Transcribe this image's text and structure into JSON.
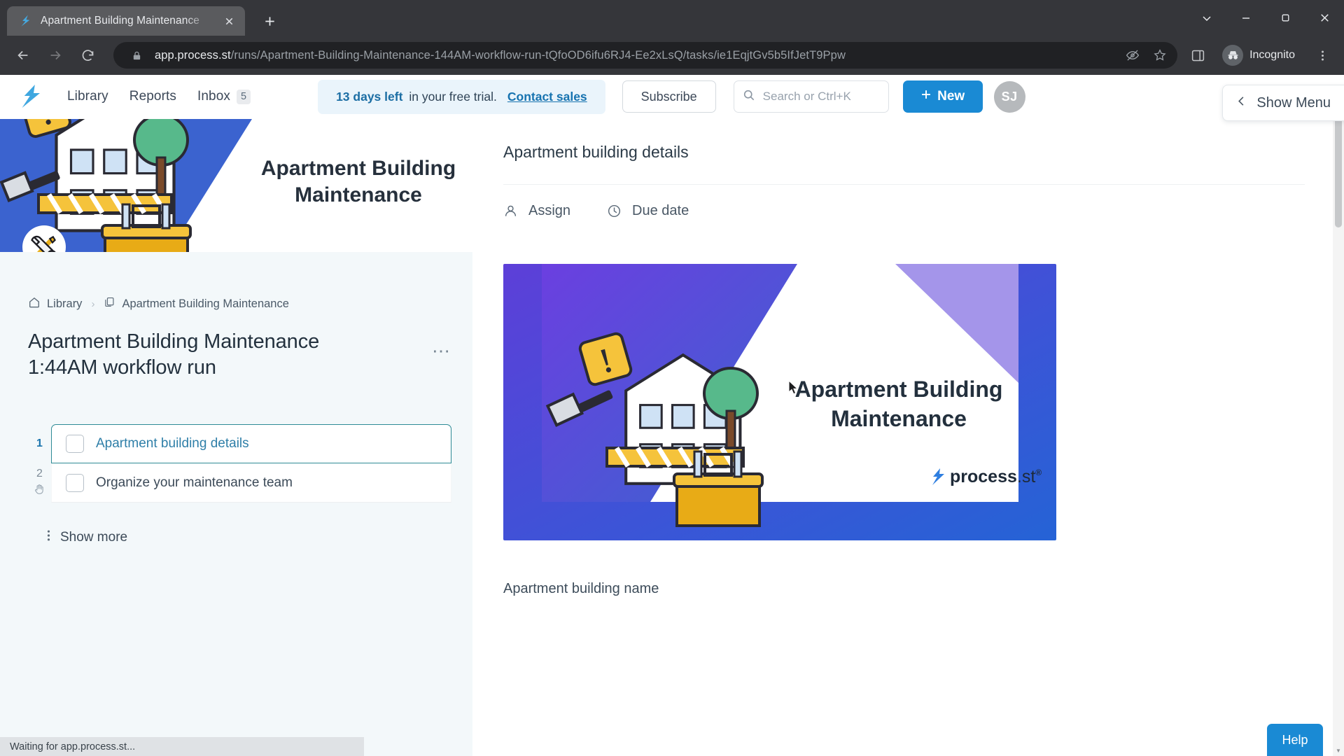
{
  "browser": {
    "tab": {
      "title": "Apartment Building Maintenance",
      "favicon_icon": "process-st-logo-icon",
      "close_icon": "close-icon"
    },
    "new_tab_icon": "plus-icon",
    "window_controls": [
      "chevron-down-icon",
      "minimize-icon",
      "maximize-icon",
      "close-icon"
    ],
    "nav": {
      "back_icon": "arrow-left-icon",
      "forward_icon": "arrow-right-icon",
      "reload_icon": "reload-icon"
    },
    "omnibox": {
      "lock_icon": "lock-icon",
      "domain": "app.process.st",
      "path": "/runs/Apartment-Building-Maintenance-144AM-workflow-run-tQfoOD6ifu6RJ4-Ee2xLsQ/tasks/ie1EqjtGv5b5IfJetT9Ppw",
      "tracking_icon": "eye-off-icon",
      "bookmark_icon": "star-icon"
    },
    "side_panel_icon": "side-panel-icon",
    "incognito_label": "Incognito",
    "incognito_icon": "incognito-icon",
    "menu_icon": "kebab-menu-icon"
  },
  "appheader": {
    "logo_icon": "process-st-logo-icon",
    "nav": [
      {
        "label": "Library",
        "name": "nav-library"
      },
      {
        "label": "Reports",
        "name": "nav-reports"
      }
    ],
    "inbox": {
      "label": "Inbox",
      "count": "5"
    },
    "trial": {
      "strong": "13 days left",
      "rest": "in your free trial.",
      "link": "Contact sales"
    },
    "subscribe_label": "Subscribe",
    "search": {
      "placeholder": "Search or Ctrl+K",
      "icon": "search-icon"
    },
    "new_button": {
      "label": "New",
      "icon": "plus-icon"
    },
    "avatar_initials": "SJ"
  },
  "left": {
    "hero": {
      "title_line1": "Apartment Building",
      "title_line2": "Maintenance",
      "badge_icon": "tools-icon"
    },
    "breadcrumb": [
      {
        "label": "Library",
        "icon": "home-icon"
      },
      {
        "label": "Apartment Building Maintenance",
        "icon": "copy-icon"
      }
    ],
    "breadcrumb_separator": "›",
    "run_title": "Apartment Building Maintenance 1:44AM workflow run",
    "more_options_icon": "ellipsis-icon",
    "tasks": [
      {
        "number": "1",
        "label": "Apartment building details",
        "checked": false,
        "active": true
      },
      {
        "number": "2",
        "label": "Organize your maintenance team",
        "checked": false,
        "active": false
      }
    ],
    "stop_icon": "hand-stop-icon",
    "show_more": {
      "label": "Show more",
      "icon": "vertical-dots-icon"
    }
  },
  "right": {
    "detail_title": "Apartment building details",
    "meta": [
      {
        "label": "Assign",
        "icon": "person-icon"
      },
      {
        "label": "Due date",
        "icon": "clock-icon"
      }
    ],
    "card": {
      "title_line1": "Apartment Building",
      "title_line2": "Maintenance",
      "brand": "process.st",
      "brand_sup": "®"
    },
    "field_label": "Apartment building name"
  },
  "overlays": {
    "show_menu": {
      "label": "Show Menu",
      "icon": "chevron-left-icon"
    },
    "help_label": "Help",
    "status_text": "Waiting for app.process.st..."
  },
  "colors": {
    "accent_blue": "#1a8ad4",
    "trial_bg": "#eaf4fb",
    "link_blue": "#1773b0",
    "active_task_border": "#2d8a95",
    "left_bg": "#f3f8fa",
    "chrome_bg": "#35363a",
    "omnibox_bg": "#202124"
  }
}
